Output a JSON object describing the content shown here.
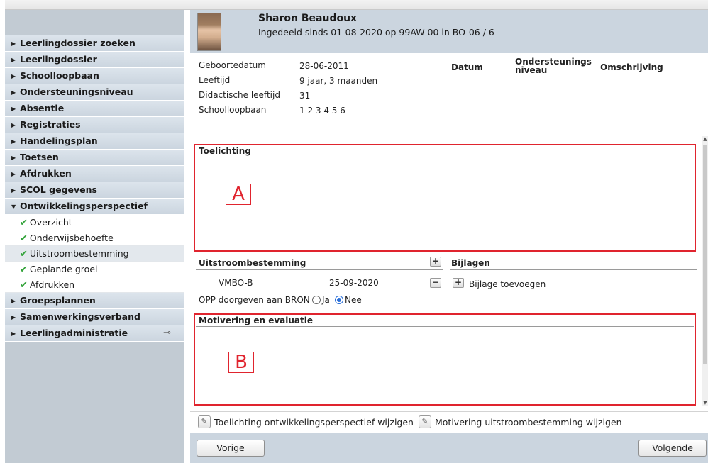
{
  "sidebar": {
    "items_top": [
      {
        "label": "Leerlingdossier zoeken"
      },
      {
        "label": "Leerlingdossier"
      },
      {
        "label": "Schoolloopbaan"
      },
      {
        "label": "Ondersteuningsniveau"
      },
      {
        "label": "Absentie"
      },
      {
        "label": "Registraties"
      },
      {
        "label": "Handelingsplan"
      },
      {
        "label": "Toetsen"
      },
      {
        "label": "Afdrukken"
      },
      {
        "label": "SCOL gegevens"
      },
      {
        "label": "Ontwikkelingsperspectief"
      }
    ],
    "sub_items": [
      {
        "label": "Overzicht"
      },
      {
        "label": "Onderwijsbehoefte"
      },
      {
        "label": "Uitstroombestemming"
      },
      {
        "label": "Geplande groei"
      },
      {
        "label": "Afdrukken"
      }
    ],
    "items_bottom": [
      {
        "label": "Groepsplannen"
      },
      {
        "label": "Samenwerkingsverband"
      },
      {
        "label": "Leerlingadministratie"
      }
    ]
  },
  "student": {
    "name": "Sharon Beaudoux",
    "subtitle": "Ingedeeld sinds 01-08-2020 op 99AW 00 in BO-06 / 6"
  },
  "details": [
    {
      "label": "Geboortedatum",
      "value": "28-06-2011"
    },
    {
      "label": "Leeftijd",
      "value": "9 jaar, 3 maanden"
    },
    {
      "label": "Didactische leeftijd",
      "value": "31"
    },
    {
      "label": "Schoolloopbaan",
      "value": "1 2 3 4 5 6"
    }
  ],
  "support_table": {
    "col_date": "Datum",
    "col_level_1": "Ondersteunings",
    "col_level_2": "niveau",
    "col_description": "Omschrijving"
  },
  "toelichting": {
    "title": "Toelichting",
    "marker": "A"
  },
  "uitstroom": {
    "title": "Uitstroombestemming",
    "entry_name": "VMBO-B",
    "entry_date": "25-09-2020",
    "opp_label": "OPP doorgeven aan BRON",
    "opt_yes": "Ja",
    "opt_no": "Nee"
  },
  "bijlagen": {
    "title": "Bijlagen",
    "add_label": "Bijlage toevoegen"
  },
  "motivering": {
    "title": "Motivering en evaluatie",
    "marker": "B"
  },
  "actions": {
    "edit_toelichting": "Toelichting ontwikkelingsperspectief wijzigen",
    "edit_motivering": "Motivering uitstroombestemming wijzigen"
  },
  "footer": {
    "prev": "Vorige",
    "next": "Volgende"
  },
  "colors": {
    "accent_red": "#e0242e",
    "header_bg": "#cbd5df",
    "sidebar_bg": "#c2cbd3",
    "check_green": "#33a33a",
    "radio_blue": "#2a6fd8"
  }
}
